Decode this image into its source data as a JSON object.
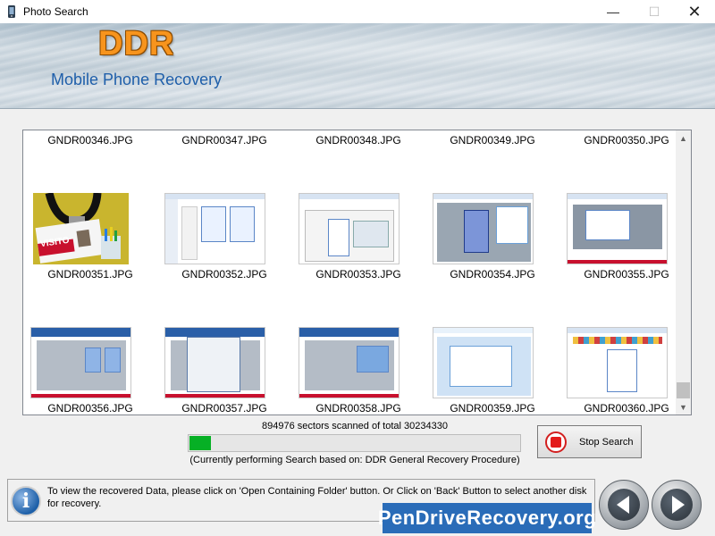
{
  "window": {
    "title": "Photo Search",
    "minimize": "—",
    "maximize": "☐",
    "close": "✕"
  },
  "banner": {
    "brand": "DDR",
    "product": "Mobile Phone Recovery"
  },
  "gallery": {
    "items": [
      "GNDR00346.JPG",
      "GNDR00347.JPG",
      "GNDR00348.JPG",
      "GNDR00349.JPG",
      "GNDR00350.JPG",
      "GNDR00351.JPG",
      "GNDR00352.JPG",
      "GNDR00353.JPG",
      "GNDR00354.JPG",
      "GNDR00355.JPG",
      "GNDR00356.JPG",
      "GNDR00357.JPG",
      "GNDR00358.JPG",
      "GNDR00359.JPG",
      "GNDR00360.JPG"
    ],
    "visitor_text": "VISITO",
    "scroll_up": "▲",
    "scroll_down": "▼"
  },
  "progress": {
    "scanned_text": "894976 sectors scanned of total 30234330",
    "fraction": 0.0296,
    "mode_text": "(Currently performing Search based on:  DDR General Recovery Procedure)"
  },
  "stop_button": {
    "label": "Stop Search"
  },
  "info": {
    "icon_glyph": "i",
    "text": "To view the recovered Data, please click on 'Open Containing Folder' button. Or Click on 'Back' Button to select another disk for recovery."
  },
  "watermark": "PenDriveRecovery.org",
  "colors": {
    "progress": "#06b025",
    "brand": "#f7941d",
    "product": "#1f5faa"
  }
}
